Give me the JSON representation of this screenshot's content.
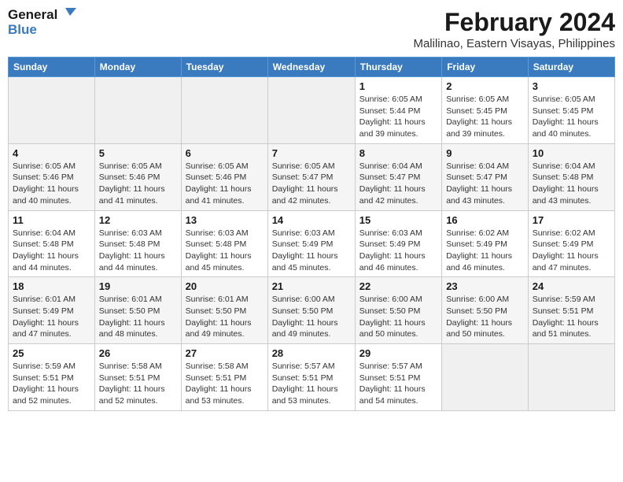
{
  "header": {
    "logo_line1": "General",
    "logo_line2": "Blue",
    "month": "February 2024",
    "location": "Malilinao, Eastern Visayas, Philippines"
  },
  "weekdays": [
    "Sunday",
    "Monday",
    "Tuesday",
    "Wednesday",
    "Thursday",
    "Friday",
    "Saturday"
  ],
  "rows": [
    {
      "cells": [
        {
          "day": "",
          "info": ""
        },
        {
          "day": "",
          "info": ""
        },
        {
          "day": "",
          "info": ""
        },
        {
          "day": "",
          "info": ""
        },
        {
          "day": "1",
          "info": "Sunrise: 6:05 AM\nSunset: 5:44 PM\nDaylight: 11 hours\nand 39 minutes."
        },
        {
          "day": "2",
          "info": "Sunrise: 6:05 AM\nSunset: 5:45 PM\nDaylight: 11 hours\nand 39 minutes."
        },
        {
          "day": "3",
          "info": "Sunrise: 6:05 AM\nSunset: 5:45 PM\nDaylight: 11 hours\nand 40 minutes."
        }
      ]
    },
    {
      "cells": [
        {
          "day": "4",
          "info": "Sunrise: 6:05 AM\nSunset: 5:46 PM\nDaylight: 11 hours\nand 40 minutes."
        },
        {
          "day": "5",
          "info": "Sunrise: 6:05 AM\nSunset: 5:46 PM\nDaylight: 11 hours\nand 41 minutes."
        },
        {
          "day": "6",
          "info": "Sunrise: 6:05 AM\nSunset: 5:46 PM\nDaylight: 11 hours\nand 41 minutes."
        },
        {
          "day": "7",
          "info": "Sunrise: 6:05 AM\nSunset: 5:47 PM\nDaylight: 11 hours\nand 42 minutes."
        },
        {
          "day": "8",
          "info": "Sunrise: 6:04 AM\nSunset: 5:47 PM\nDaylight: 11 hours\nand 42 minutes."
        },
        {
          "day": "9",
          "info": "Sunrise: 6:04 AM\nSunset: 5:47 PM\nDaylight: 11 hours\nand 43 minutes."
        },
        {
          "day": "10",
          "info": "Sunrise: 6:04 AM\nSunset: 5:48 PM\nDaylight: 11 hours\nand 43 minutes."
        }
      ]
    },
    {
      "cells": [
        {
          "day": "11",
          "info": "Sunrise: 6:04 AM\nSunset: 5:48 PM\nDaylight: 11 hours\nand 44 minutes."
        },
        {
          "day": "12",
          "info": "Sunrise: 6:03 AM\nSunset: 5:48 PM\nDaylight: 11 hours\nand 44 minutes."
        },
        {
          "day": "13",
          "info": "Sunrise: 6:03 AM\nSunset: 5:48 PM\nDaylight: 11 hours\nand 45 minutes."
        },
        {
          "day": "14",
          "info": "Sunrise: 6:03 AM\nSunset: 5:49 PM\nDaylight: 11 hours\nand 45 minutes."
        },
        {
          "day": "15",
          "info": "Sunrise: 6:03 AM\nSunset: 5:49 PM\nDaylight: 11 hours\nand 46 minutes."
        },
        {
          "day": "16",
          "info": "Sunrise: 6:02 AM\nSunset: 5:49 PM\nDaylight: 11 hours\nand 46 minutes."
        },
        {
          "day": "17",
          "info": "Sunrise: 6:02 AM\nSunset: 5:49 PM\nDaylight: 11 hours\nand 47 minutes."
        }
      ]
    },
    {
      "cells": [
        {
          "day": "18",
          "info": "Sunrise: 6:01 AM\nSunset: 5:49 PM\nDaylight: 11 hours\nand 47 minutes."
        },
        {
          "day": "19",
          "info": "Sunrise: 6:01 AM\nSunset: 5:50 PM\nDaylight: 11 hours\nand 48 minutes."
        },
        {
          "day": "20",
          "info": "Sunrise: 6:01 AM\nSunset: 5:50 PM\nDaylight: 11 hours\nand 49 minutes."
        },
        {
          "day": "21",
          "info": "Sunrise: 6:00 AM\nSunset: 5:50 PM\nDaylight: 11 hours\nand 49 minutes."
        },
        {
          "day": "22",
          "info": "Sunrise: 6:00 AM\nSunset: 5:50 PM\nDaylight: 11 hours\nand 50 minutes."
        },
        {
          "day": "23",
          "info": "Sunrise: 6:00 AM\nSunset: 5:50 PM\nDaylight: 11 hours\nand 50 minutes."
        },
        {
          "day": "24",
          "info": "Sunrise: 5:59 AM\nSunset: 5:51 PM\nDaylight: 11 hours\nand 51 minutes."
        }
      ]
    },
    {
      "cells": [
        {
          "day": "25",
          "info": "Sunrise: 5:59 AM\nSunset: 5:51 PM\nDaylight: 11 hours\nand 52 minutes."
        },
        {
          "day": "26",
          "info": "Sunrise: 5:58 AM\nSunset: 5:51 PM\nDaylight: 11 hours\nand 52 minutes."
        },
        {
          "day": "27",
          "info": "Sunrise: 5:58 AM\nSunset: 5:51 PM\nDaylight: 11 hours\nand 53 minutes."
        },
        {
          "day": "28",
          "info": "Sunrise: 5:57 AM\nSunset: 5:51 PM\nDaylight: 11 hours\nand 53 minutes."
        },
        {
          "day": "29",
          "info": "Sunrise: 5:57 AM\nSunset: 5:51 PM\nDaylight: 11 hours\nand 54 minutes."
        },
        {
          "day": "",
          "info": ""
        },
        {
          "day": "",
          "info": ""
        }
      ]
    }
  ]
}
